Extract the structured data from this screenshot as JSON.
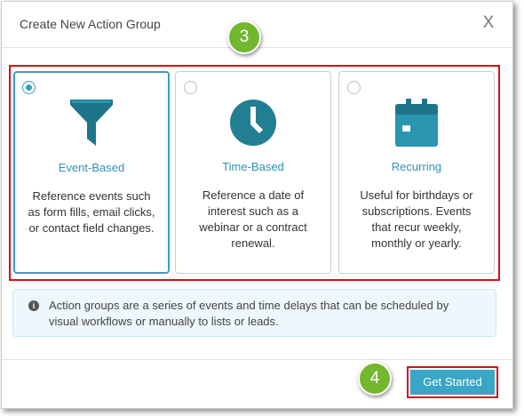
{
  "dialog": {
    "title": "Create New Action Group",
    "close_label": "X"
  },
  "annotations": {
    "step_3": "3",
    "step_4": "4"
  },
  "cards": [
    {
      "title": "Event-Based",
      "description": "Reference events such as form fills, email clicks, or contact field changes.",
      "icon": "funnel-icon",
      "selected": true
    },
    {
      "title": "Time-Based",
      "description": "Reference a date of interest such as a webinar or a contract renewal.",
      "icon": "clock-icon",
      "selected": false
    },
    {
      "title": "Recurring",
      "description": "Useful for birthdays or subscriptions. Events that recur weekly, monthly or yearly.",
      "icon": "calendar-icon",
      "selected": false
    }
  ],
  "info": {
    "icon": "info-icon",
    "text": "Action groups are a series of events and time delays that can be scheduled by visual workflows or manually to lists or leads."
  },
  "footer": {
    "get_started_label": "Get Started"
  },
  "colors": {
    "accent": "#38a6c5",
    "icon_dark": "#1e7589",
    "step_badge": "#73b72f",
    "highlight": "#d6101b"
  }
}
